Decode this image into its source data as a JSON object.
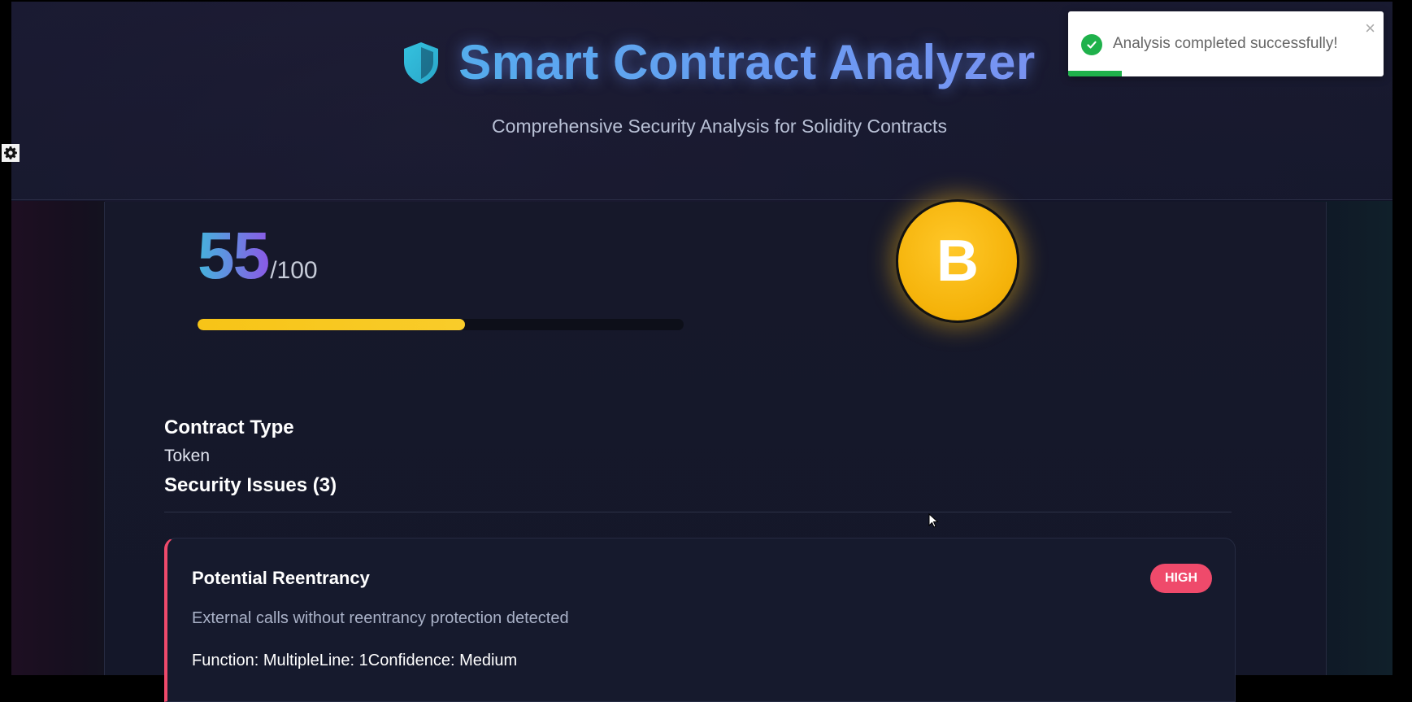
{
  "header": {
    "title": "Smart Contract Analyzer",
    "subtitle": "Comprehensive Security Analysis for Solidity Contracts"
  },
  "score": {
    "value": "55",
    "max": "/100",
    "progress_fraction": 0.55
  },
  "grade": {
    "letter": "B"
  },
  "contract": {
    "type_label": "Contract Type",
    "type_value": "Token"
  },
  "security": {
    "heading": "Security Issues (3)"
  },
  "issues": [
    {
      "title": "Potential Reentrancy",
      "severity": "HIGH",
      "description": "External calls without reentrancy protection detected",
      "meta": "Function: MultipleLine: 1Confidence: Medium"
    }
  ],
  "toast": {
    "message": "Analysis completed successfully!",
    "close_symbol": "×",
    "progress_fraction": 0.17
  },
  "icons": {
    "header": "shield-icon",
    "settings": "gear-icon",
    "toast": "check-circle-icon",
    "close": "close-icon"
  },
  "colors": {
    "accent_blue": "#4fb3e8",
    "grade_gold": "#f5b30a",
    "progress_yellow": "#f7c417",
    "severity_high": "#ef4a6b",
    "success_green": "#1fb14b"
  }
}
